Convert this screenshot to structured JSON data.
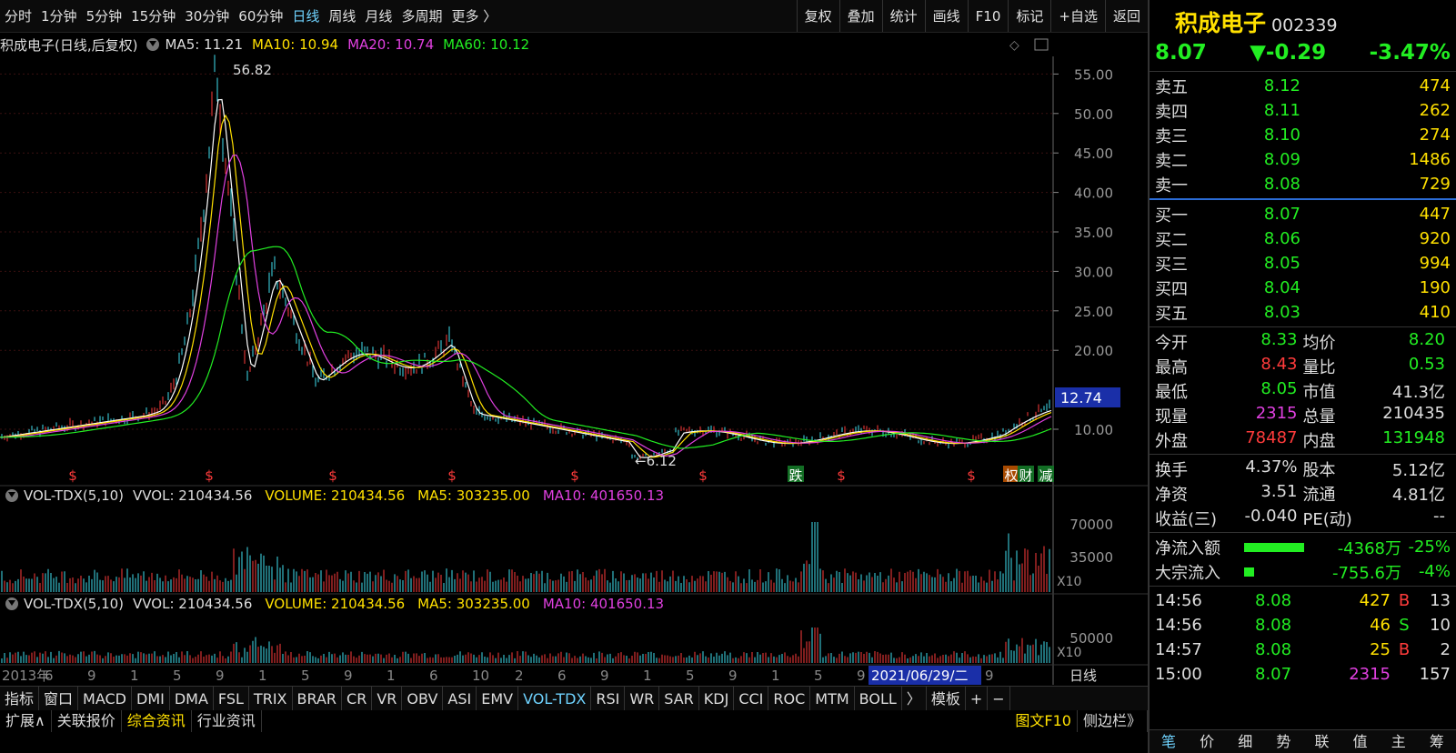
{
  "topbar": {
    "periods": [
      "分时",
      "1分钟",
      "5分钟",
      "15分钟",
      "30分钟",
      "60分钟",
      "日线",
      "周线",
      "月线",
      "多周期",
      "更多 〉"
    ],
    "active_period": "日线",
    "tools": [
      "复权",
      "叠加",
      "统计",
      "画线",
      "F10",
      "标记",
      "+自选",
      "返回"
    ]
  },
  "chart_header": {
    "title": "积成电子(日线,后复权)",
    "ma5": "MA5: 11.21",
    "ma10": "MA10: 10.94",
    "ma20": "MA20: 10.74",
    "ma60": "MA60: 10.12"
  },
  "main_chart": {
    "y_ticks": [
      "55.00",
      "50.00",
      "45.00",
      "40.00",
      "35.00",
      "30.00",
      "25.00",
      "20.00",
      "10.00"
    ],
    "last_price_tag": "12.74",
    "high_label": "56.82",
    "low_label": "6.12",
    "markers": [
      "$",
      "$",
      "$",
      "$",
      "$",
      "$",
      "跌",
      "$",
      "$",
      "权",
      "财",
      "减"
    ]
  },
  "vol_header_1": {
    "name": "VOL-TDX(5,10)",
    "vvol": "VVOL: 210434.56",
    "volume": "VOLUME: 210434.56",
    "ma5": "MA5: 303235.00",
    "ma10": "MA10: 401650.13"
  },
  "vol_header_2": {
    "name": "VOL-TDX(5,10)",
    "vvol": "VVOL: 210434.56",
    "volume": "VOLUME: 210434.56",
    "ma5": "MA5: 303235.00",
    "ma10": "MA10: 401650.13"
  },
  "vol_axis_1": [
    "70000",
    "35000",
    "X10"
  ],
  "vol_axis_2": [
    "50000",
    "X10"
  ],
  "x_axis": {
    "labels": [
      "2013年",
      "6",
      "9",
      "1",
      "5",
      "9",
      "1",
      "5",
      "9",
      "1",
      "6",
      "10",
      "2",
      "6",
      "9",
      "1",
      "5",
      "9",
      "1",
      "5",
      "9",
      "1",
      "5",
      "9"
    ],
    "cursor_date": "2021/06/29/二",
    "period_label": "日线"
  },
  "indicators": [
    "指标",
    "窗口",
    "MACD",
    "DMI",
    "DMA",
    "FSL",
    "TRIX",
    "BRAR",
    "CR",
    "VR",
    "OBV",
    "ASI",
    "EMV",
    "VOL-TDX",
    "RSI",
    "WR",
    "SAR",
    "KDJ",
    "CCI",
    "ROC",
    "MTM",
    "BOLL",
    "〉",
    "模板",
    "+",
    "−"
  ],
  "active_indicator": "VOL-TDX",
  "status_bar": [
    "扩展∧",
    "关联报价",
    "综合资讯",
    "行业资讯"
  ],
  "status_right": [
    "图文F10",
    "侧边栏》"
  ],
  "quote": {
    "name": "积成电子",
    "code": "002339",
    "price": "8.07",
    "change": "▼-0.29",
    "change_pct": "-3.47%",
    "sell": [
      {
        "label": "卖五",
        "price": "8.12",
        "vol": "474"
      },
      {
        "label": "卖四",
        "price": "8.11",
        "vol": "262"
      },
      {
        "label": "卖三",
        "price": "8.10",
        "vol": "274"
      },
      {
        "label": "卖二",
        "price": "8.09",
        "vol": "1486"
      },
      {
        "label": "卖一",
        "price": "8.08",
        "vol": "729"
      }
    ],
    "buy": [
      {
        "label": "买一",
        "price": "8.07",
        "vol": "447"
      },
      {
        "label": "买二",
        "price": "8.06",
        "vol": "920"
      },
      {
        "label": "买三",
        "price": "8.05",
        "vol": "994"
      },
      {
        "label": "买四",
        "price": "8.04",
        "vol": "190"
      },
      {
        "label": "买五",
        "price": "8.03",
        "vol": "410"
      }
    ],
    "stats": [
      [
        {
          "k": "今开",
          "v": "8.33",
          "c": "#22ee22"
        },
        {
          "k": "均价",
          "v": "8.20",
          "c": "#22ee22"
        }
      ],
      [
        {
          "k": "最高",
          "v": "8.43",
          "c": "#ff3b3b"
        },
        {
          "k": "量比",
          "v": "0.53",
          "c": "#22ee22"
        }
      ],
      [
        {
          "k": "最低",
          "v": "8.05",
          "c": "#22ee22"
        },
        {
          "k": "市值",
          "v": "41.3亿",
          "c": "#dddddd"
        }
      ],
      [
        {
          "k": "现量",
          "v": "2315",
          "c": "#e040e0"
        },
        {
          "k": "总量",
          "v": "210435",
          "c": "#dddddd"
        }
      ],
      [
        {
          "k": "外盘",
          "v": "78487",
          "c": "#ff3b3b"
        },
        {
          "k": "内盘",
          "v": "131948",
          "c": "#22ee22"
        }
      ]
    ],
    "stats2": [
      [
        {
          "k": "换手",
          "v": "4.37%",
          "c": "#dddddd"
        },
        {
          "k": "股本",
          "v": "5.12亿",
          "c": "#dddddd"
        }
      ],
      [
        {
          "k": "净资",
          "v": "3.51",
          "c": "#dddddd"
        },
        {
          "k": "流通",
          "v": "4.81亿",
          "c": "#dddddd"
        }
      ],
      [
        {
          "k": "收益(三)",
          "v": "-0.040",
          "c": "#dddddd"
        },
        {
          "k": "PE(动)",
          "v": "--",
          "c": "#dddddd"
        }
      ]
    ],
    "flow": [
      {
        "k": "净流入额",
        "v": "-4368万",
        "pct": "-25%",
        "bar": 0.25
      },
      {
        "k": "大宗流入",
        "v": "-755.6万",
        "pct": "-4%",
        "bar": 0.04
      }
    ],
    "ticks": [
      {
        "t": "14:56",
        "p": "8.08",
        "v": "427",
        "bs": "B",
        "n": "13"
      },
      {
        "t": "14:56",
        "p": "8.08",
        "v": "46",
        "bs": "S",
        "n": "10"
      },
      {
        "t": "14:57",
        "p": "8.08",
        "v": "25",
        "bs": "B",
        "n": "2"
      },
      {
        "t": "15:00",
        "p": "8.07",
        "v": "2315",
        "bs": "",
        "n": "157"
      }
    ],
    "tabs": [
      "笔",
      "价",
      "细",
      "势",
      "联",
      "值",
      "主",
      "筹"
    ]
  },
  "colors": {
    "up": "#ff3b3b",
    "down": "#22ee22",
    "accent": "#6fd3ff",
    "yellow": "#ffe000",
    "magenta": "#e040e0"
  }
}
